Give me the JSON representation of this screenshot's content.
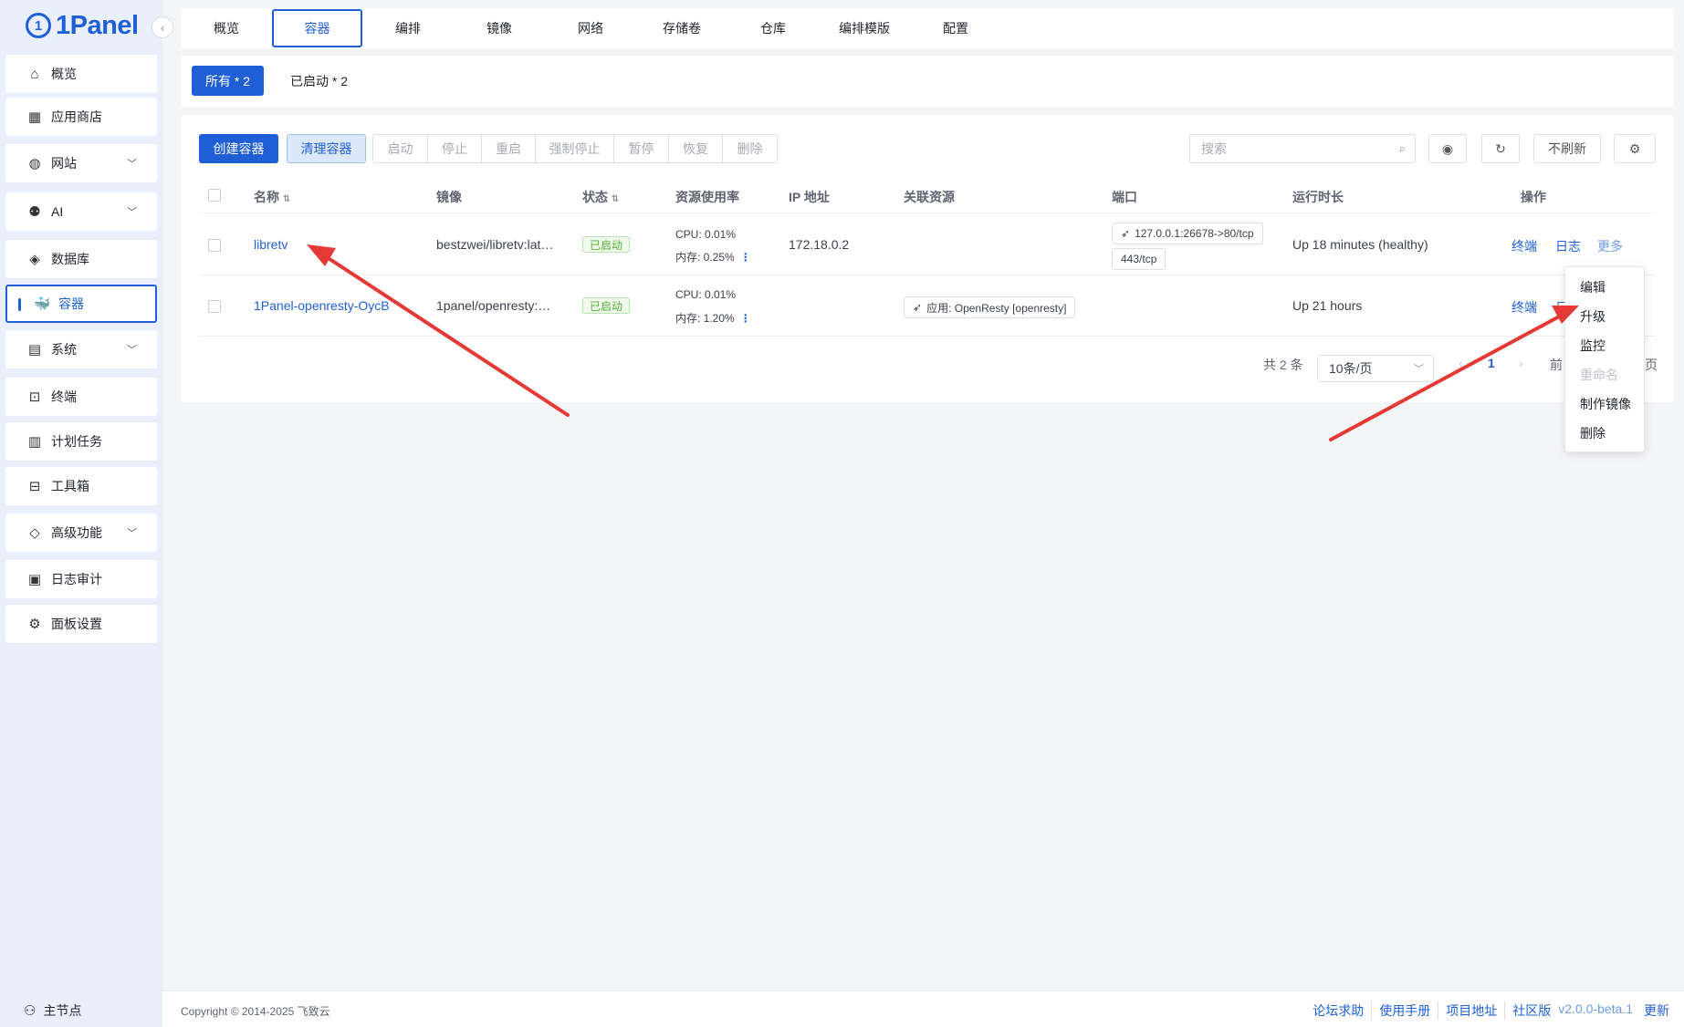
{
  "app": {
    "logo_text": "1Panel",
    "logo_mark": "1",
    "accent": "#1f5fd6"
  },
  "sidebar": {
    "items": [
      {
        "label": "概览",
        "icon": "home-icon"
      },
      {
        "label": "应用商店",
        "icon": "grid-icon"
      },
      {
        "label": "网站",
        "icon": "globe-icon",
        "expand": true
      },
      {
        "label": "AI",
        "icon": "robot-icon",
        "expand": true
      },
      {
        "label": "数据库",
        "icon": "layers-icon"
      },
      {
        "label": "容器",
        "icon": "docker-icon",
        "active": true
      },
      {
        "label": "系统",
        "icon": "system-icon",
        "expand": true
      },
      {
        "label": "终端",
        "icon": "terminal-icon"
      },
      {
        "label": "计划任务",
        "icon": "calendar-icon"
      },
      {
        "label": "工具箱",
        "icon": "toolbox-icon"
      },
      {
        "label": "高级功能",
        "icon": "diamond-icon",
        "expand": true
      },
      {
        "label": "日志审计",
        "icon": "log-icon"
      },
      {
        "label": "面板设置",
        "icon": "gear-icon"
      }
    ],
    "node_label": "主节点"
  },
  "topnav": {
    "tabs": [
      "概览",
      "容器",
      "编排",
      "镜像",
      "网络",
      "存储卷",
      "仓库",
      "编排模版",
      "配置"
    ],
    "active": "容器"
  },
  "filters": {
    "all": "所有 * 2",
    "running": "已启动 * 2"
  },
  "toolbar": {
    "create": "创建容器",
    "clean": "清理容器",
    "group": [
      "启动",
      "停止",
      "重启",
      "强制停止",
      "暂停",
      "恢复",
      "删除"
    ],
    "search_placeholder": "搜索",
    "no_refresh": "不刷新"
  },
  "table": {
    "columns": [
      "名称",
      "镜像",
      "状态",
      "资源使用率",
      "IP 地址",
      "关联资源",
      "端口",
      "运行时长",
      "操作"
    ],
    "rows": [
      {
        "name": "libretv",
        "image": "bestzwei/libretv:lat…",
        "status": "已启动",
        "cpu": "CPU: 0.01%",
        "mem": "内存: 0.25%",
        "ip": "172.18.0.2",
        "related": "",
        "ports": [
          "127.0.0.1:26678->80/tcp",
          "443/tcp"
        ],
        "uptime": "Up 18 minutes (healthy)",
        "op_terminal": "终端",
        "op_log": "日志",
        "op_more": "更多"
      },
      {
        "name": "1Panel-openresty-OycB",
        "image": "1panel/openresty:…",
        "status": "已启动",
        "cpu": "CPU: 0.01%",
        "mem": "内存: 1.20%",
        "ip": "",
        "related": "应用: OpenResty [openresty]",
        "ports": [],
        "uptime": "Up 21 hours",
        "op_terminal": "终端",
        "op_log": "日"
      }
    ]
  },
  "pagination": {
    "total": "共 2 条",
    "page_size": "10条/页",
    "page": "1",
    "prev_text": "前",
    "trail": "页"
  },
  "more_menu": [
    {
      "label": "编辑"
    },
    {
      "label": "升级"
    },
    {
      "label": "监控"
    },
    {
      "label": "重命名",
      "disabled": true
    },
    {
      "label": "制作镜像"
    },
    {
      "label": "删除"
    }
  ],
  "footer": {
    "copyright": "Copyright © 2014-2025 飞致云",
    "links": [
      "论坛求助",
      "使用手册",
      "项目地址",
      "社区版"
    ],
    "version": "v2.0.0-beta.1",
    "update": "更新"
  }
}
